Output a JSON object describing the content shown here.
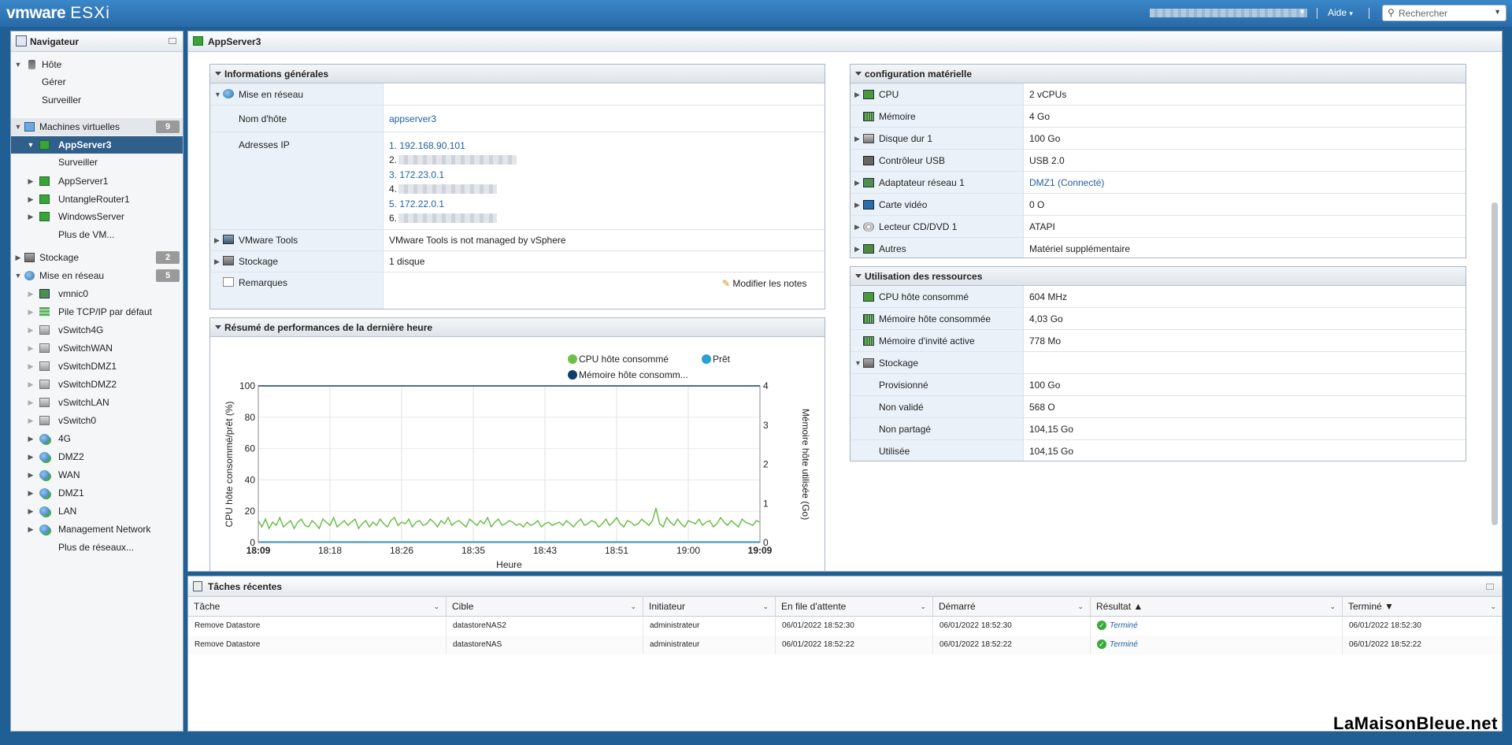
{
  "topbar": {
    "brand_vm": "vmware",
    "brand_esxi": "ESXi",
    "help": "Aide",
    "search_placeholder": "Rechercher"
  },
  "navigator": {
    "title": "Navigateur",
    "host": "Hôte",
    "host_manage": "Gérer",
    "host_monitor": "Surveiller",
    "vms_label": "Machines virtuelles",
    "vms_count": "9",
    "vm_selected": "AppServer3",
    "vm_selected_monitor": "Surveiller",
    "vms": [
      "AppServer1",
      "UntangleRouter1",
      "WindowsServer"
    ],
    "more_vms": "Plus de VM...",
    "storage_label": "Stockage",
    "storage_count": "2",
    "network_label": "Mise en réseau",
    "network_count": "5",
    "network_items": [
      "vmnic0",
      "Pile TCP/IP par défaut",
      "vSwitch4G",
      "vSwitchWAN",
      "vSwitchDMZ1",
      "vSwitchDMZ2",
      "vSwitchLAN",
      "vSwitch0"
    ],
    "portgroups": [
      "4G",
      "DMZ2",
      "WAN",
      "DMZ1",
      "LAN",
      "Management Network"
    ],
    "more_networks": "Plus de réseaux..."
  },
  "main": {
    "title": "AppServer3",
    "general": {
      "title": "Informations générales",
      "networking": "Mise en réseau",
      "hostname_label": "Nom d'hôte",
      "hostname": "appserver3",
      "ip_label": "Adresses IP",
      "ips": [
        "1. 192.168.90.101",
        "2.",
        "3. 172.23.0.1",
        "4.",
        "5. 172.22.0.1",
        "6."
      ],
      "tools_label": "VMware Tools",
      "tools_value": "VMware Tools is not managed by vSphere",
      "storage_label": "Stockage",
      "storage_value": "1 disque",
      "notes_label": "Remarques",
      "edit_notes": "Modifier les notes"
    },
    "performance": {
      "title": "Résumé de performances de la dernière heure"
    },
    "hardware": {
      "title": "configuration matérielle",
      "rows": [
        {
          "label": "CPU",
          "value": "2 vCPUs"
        },
        {
          "label": "Mémoire",
          "value": "4 Go"
        },
        {
          "label": "Disque dur 1",
          "value": "100 Go"
        },
        {
          "label": "Contrôleur USB",
          "value": "USB 2.0"
        },
        {
          "label": "Adaptateur réseau 1",
          "value": "DMZ1 (Connecté)"
        },
        {
          "label": "Carte vidéo",
          "value": "0 O"
        },
        {
          "label": "Lecteur CD/DVD 1",
          "value": "ATAPI"
        },
        {
          "label": "Autres",
          "value": "Matériel supplémentaire"
        }
      ]
    },
    "resources": {
      "title": "Utilisation des ressources",
      "rows": [
        {
          "label": "CPU hôte consommé",
          "value": "604 MHz"
        },
        {
          "label": "Mémoire hôte consommée",
          "value": "4,03 Go"
        },
        {
          "label": "Mémoire d'invité active",
          "value": "778 Mo"
        },
        {
          "label": "Stockage",
          "value": ""
        },
        {
          "label": "Provisionné",
          "value": "100 Go"
        },
        {
          "label": "Non validé",
          "value": "568 O"
        },
        {
          "label": "Non partagé",
          "value": "104,15 Go"
        },
        {
          "label": "Utilisée",
          "value": "104,15 Go"
        }
      ]
    }
  },
  "chart_data": {
    "type": "line",
    "legend": [
      "CPU hôte consommé",
      "Prêt",
      "Mémoire hôte consomm..."
    ],
    "legend_colors": [
      "#6cbf4a",
      "#2a9fd8",
      "#0f3d6e"
    ],
    "xlabel": "Heure",
    "ylabel": "CPU hôte consommé/prêt (%)",
    "y2label": "Mémoire hôte utilisée (Go)",
    "ylim": [
      0,
      100
    ],
    "y2lim": [
      0,
      4
    ],
    "yticks": [
      "0",
      "20",
      "40",
      "60",
      "80",
      "100"
    ],
    "y2ticks": [
      "0",
      "1",
      "2",
      "3",
      "4"
    ],
    "xticks": [
      "18:09",
      "18:18",
      "18:26",
      "18:35",
      "18:43",
      "18:51",
      "19:00",
      "19:09"
    ],
    "series": [
      {
        "name": "CPU hôte consommé",
        "values": [
          14,
          10,
          15,
          9,
          13,
          11,
          16,
          10,
          12,
          14,
          9,
          13,
          15,
          11,
          10,
          14,
          12,
          9,
          15,
          13,
          11,
          16,
          10,
          12,
          14,
          11,
          13,
          15,
          9,
          12,
          14,
          10,
          13,
          11,
          15,
          12,
          10,
          14,
          16,
          11,
          13,
          12,
          15,
          10,
          13,
          14,
          11,
          12,
          15,
          13,
          10,
          14,
          12,
          16,
          11,
          13,
          14,
          12,
          10,
          15,
          13,
          11,
          14,
          12,
          16,
          10,
          13,
          15,
          11,
          12,
          14,
          13,
          11,
          12,
          10,
          13,
          11,
          12,
          14,
          10,
          12,
          13,
          11,
          12,
          13,
          11,
          14,
          12,
          10,
          13,
          15,
          11,
          12,
          14,
          13,
          10,
          12,
          15,
          11,
          13,
          16,
          12,
          10,
          14,
          13,
          11,
          12,
          15,
          13,
          11,
          14,
          22,
          12,
          10,
          16,
          13,
          11,
          15,
          12,
          10,
          14,
          13,
          12,
          15,
          11,
          13,
          14,
          10,
          12,
          16,
          13,
          11,
          14,
          12,
          10,
          15,
          13,
          12,
          11,
          14,
          13
        ]
      },
      {
        "name": "Prêt",
        "values": [
          0.5,
          0.5,
          0.5,
          0.5,
          0.5,
          0.5,
          0.5,
          0.5
        ]
      },
      {
        "name": "Mémoire hôte consomm...",
        "values": [
          4,
          4,
          4,
          4,
          4,
          4,
          4,
          4
        ]
      }
    ]
  },
  "tasks": {
    "title": "Tâches récentes",
    "columns": [
      "Tâche",
      "Cible",
      "Initiateur",
      "En file d'attente",
      "Démarré",
      "Résultat ▲",
      "Terminé ▼"
    ],
    "rows": [
      [
        "Remove Datastore",
        "datastoreNAS2",
        "administrateur",
        "06/01/2022 18:52:30",
        "06/01/2022 18:52:30",
        "Terminé",
        "06/01/2022 18:52:30"
      ],
      [
        "Remove Datastore",
        "datastoreNAS",
        "administrateur",
        "06/01/2022 18:52:22",
        "06/01/2022 18:52:22",
        "Terminé",
        "06/01/2022 18:52:22"
      ]
    ]
  },
  "watermark": "LaMaisonBleue.net"
}
